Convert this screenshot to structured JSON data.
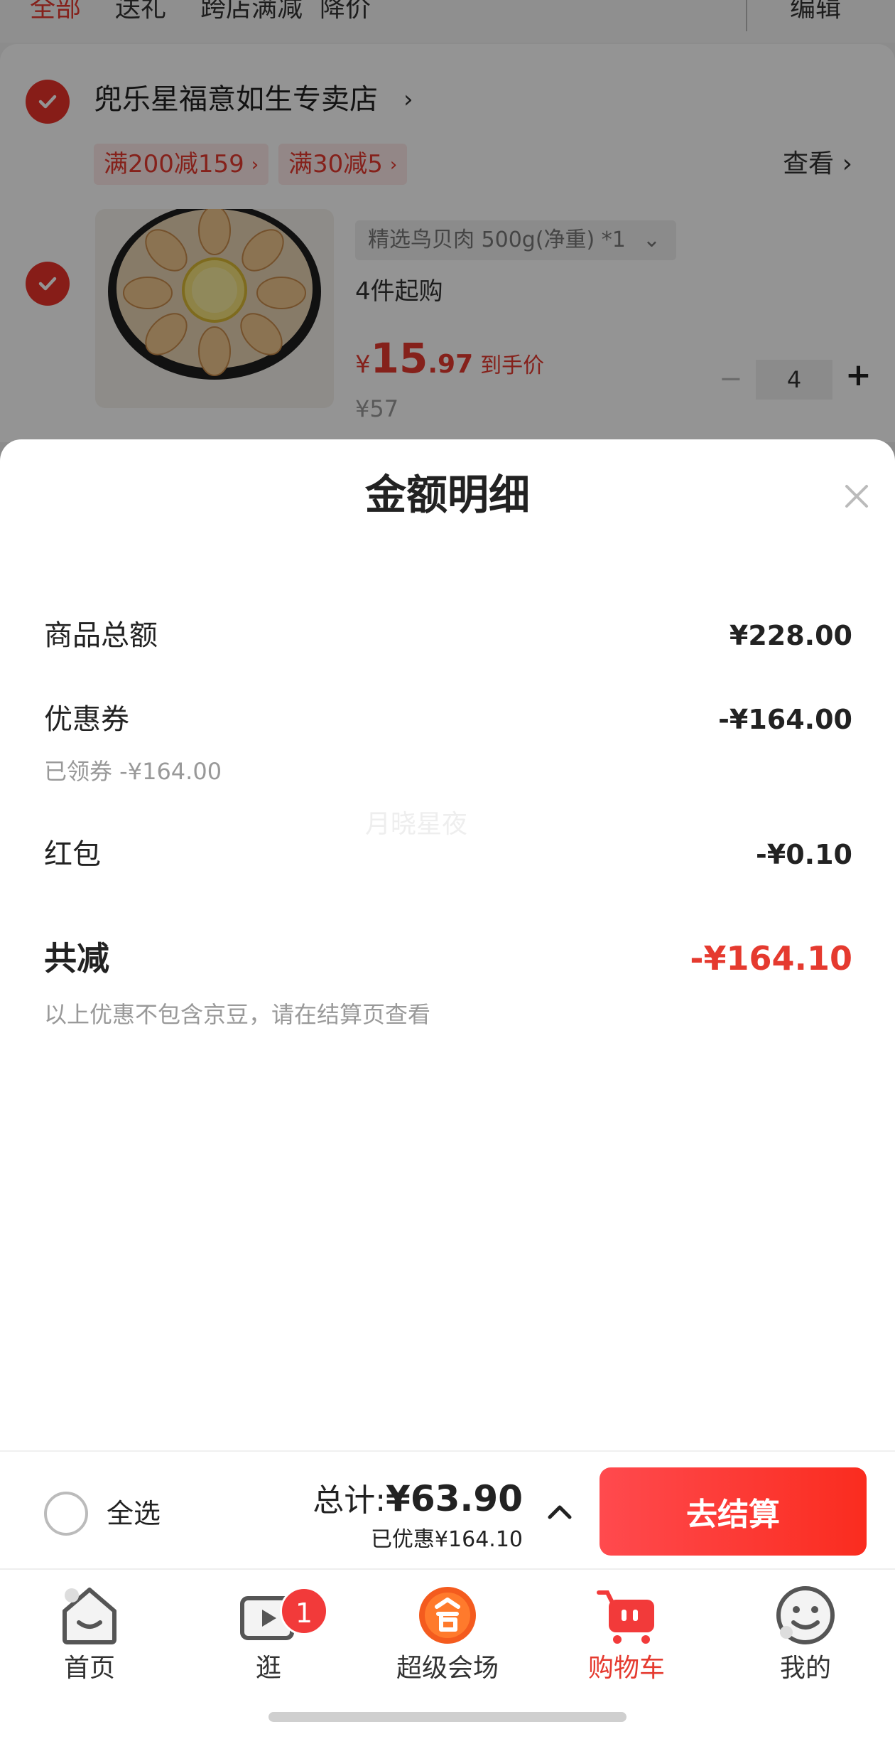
{
  "filter_tabs": [
    {
      "label": "全部",
      "active": true
    },
    {
      "label": "送礼",
      "active": false
    },
    {
      "label": "跨店满减",
      "active": false
    },
    {
      "label": "降价",
      "active": false
    }
  ],
  "edit_label": "编辑",
  "store": {
    "name": "兜乐星福意如生专卖店",
    "promos": [
      "满200减159",
      "满30减5"
    ],
    "view_label": "查看"
  },
  "product": {
    "variant": "精选鸟贝肉 500g(净重) *1",
    "min_order": "4件起购",
    "price_currency": "¥",
    "price_int": "15",
    "price_dec": ".97",
    "price_label": "到手价",
    "original_price": "¥57",
    "quantity": "4",
    "minus": "−",
    "plus": "+"
  },
  "sheet": {
    "title": "金额明细",
    "rows": {
      "goods_total": {
        "label": "商品总额",
        "value": "¥228.00"
      },
      "coupon": {
        "label": "优惠券",
        "value": "-¥164.00",
        "sub": "已领券 -¥164.00"
      },
      "red_packet": {
        "label": "红包",
        "value": "-¥0.10"
      },
      "total_discount": {
        "label": "共减",
        "value": "-¥164.10",
        "note": "以上优惠不包含京豆，请在结算页查看"
      }
    },
    "watermark": "月晓星夜"
  },
  "checkout": {
    "select_all": "全选",
    "total_label": "总计:",
    "total_value": "¥63.90",
    "saved": "已优惠¥164.10",
    "button": "去结算"
  },
  "tabbar": [
    {
      "label": "首页",
      "icon": "home-icon",
      "active": false
    },
    {
      "label": "逛",
      "icon": "video-icon",
      "active": false,
      "badge": "1"
    },
    {
      "label": "超级会场",
      "icon": "super-venue-icon",
      "active": false
    },
    {
      "label": "购物车",
      "icon": "cart-icon",
      "active": true
    },
    {
      "label": "我的",
      "icon": "smiley-icon",
      "active": false
    }
  ],
  "colors": {
    "accent_red": "#e53a2f",
    "checkout_gradient_start": "#ff4a4e",
    "checkout_gradient_end": "#fa2c1f"
  }
}
